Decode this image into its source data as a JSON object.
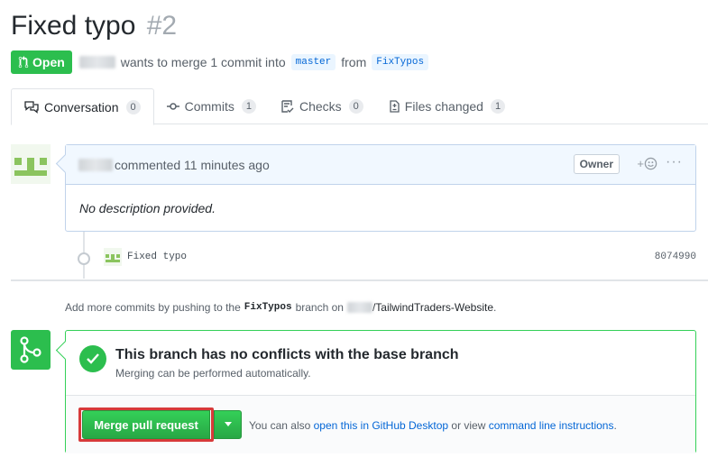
{
  "pr": {
    "title": "Fixed typo",
    "number": "#2",
    "state": "Open",
    "summary": "wants to merge 1 commit into",
    "base_branch": "master",
    "from_text": "from",
    "head_branch": "FixTypos"
  },
  "tabs": [
    {
      "label": "Conversation",
      "count": "0",
      "icon": "comment-discussion-icon"
    },
    {
      "label": "Commits",
      "count": "1",
      "icon": "git-commit-icon"
    },
    {
      "label": "Checks",
      "count": "0",
      "icon": "checklist-icon"
    },
    {
      "label": "Files changed",
      "count": "1",
      "icon": "diff-icon"
    }
  ],
  "comment": {
    "action": "commented 11 minutes ago",
    "role": "Owner",
    "reaction": "+",
    "more": "···",
    "body": "No description provided."
  },
  "commit": {
    "message": "Fixed typo",
    "sha": "8074990"
  },
  "hint": {
    "prefix": "Add more commits by pushing to the",
    "branch": "FixTypos",
    "middle": "branch on",
    "repo": "/TailwindTraders-Website",
    "suffix": "."
  },
  "merge": {
    "title": "This branch has no conflicts with the base branch",
    "subtitle": "Merging can be performed automatically.",
    "button": "Merge pull request",
    "alt_prefix": "You can also",
    "alt_link1": "open this in GitHub Desktop",
    "alt_middle": "or view",
    "alt_link2": "command line instructions",
    "alt_suffix": "."
  },
  "colors": {
    "open_green": "#2cbe4e",
    "link_blue": "#0366d6",
    "highlight_red": "#d73a3a"
  }
}
